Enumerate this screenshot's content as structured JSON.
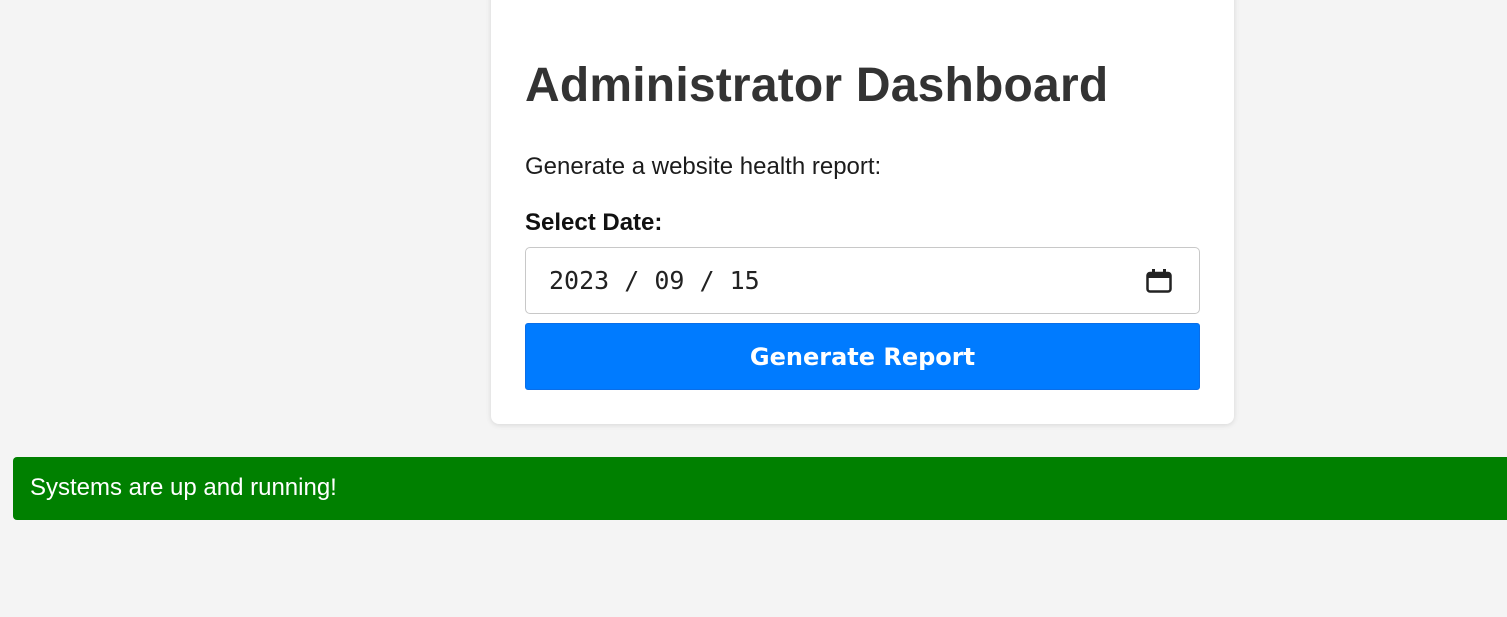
{
  "dashboard": {
    "title": "Administrator Dashboard",
    "intro": "Generate a website health report:",
    "date_label": "Select Date:",
    "date_value": "2023 / 09 / 15",
    "calendar_icon": "calendar-icon",
    "button_label": "Generate Report"
  },
  "status": {
    "message": "Systems are up and running!",
    "color": "#008000"
  },
  "colors": {
    "accent": "#007bff",
    "background": "#f4f4f4",
    "card": "#ffffff"
  }
}
